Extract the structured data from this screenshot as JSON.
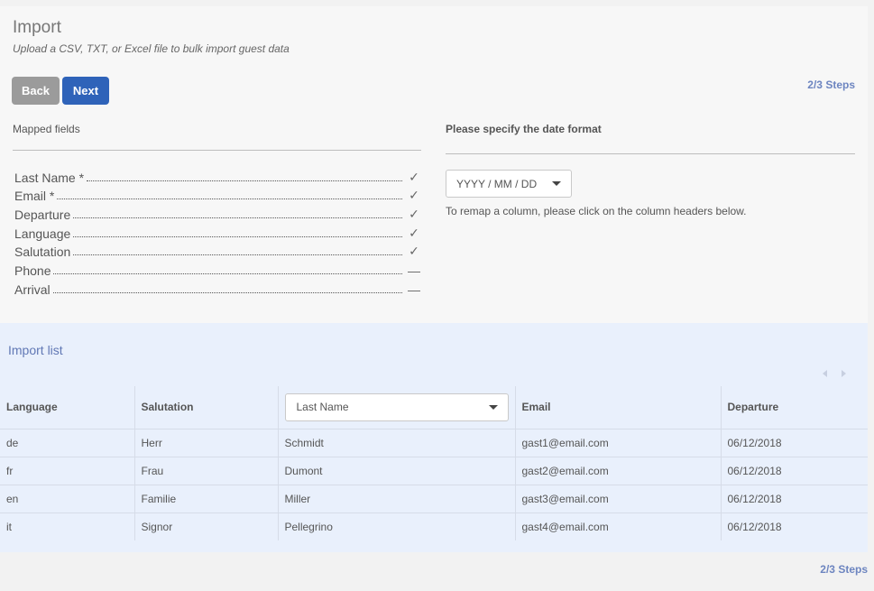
{
  "header": {
    "title": "Import",
    "subtitle": "Upload a CSV, TXT, or Excel file to bulk import guest data"
  },
  "actions": {
    "back_label": "Back",
    "next_label": "Next"
  },
  "steps": {
    "top": "2/3 Steps",
    "bottom": "2/3 Steps"
  },
  "mapped_fields": {
    "header": "Mapped fields",
    "items": [
      {
        "label": "Last Name *",
        "status": "✓",
        "status_icon": "check-icon"
      },
      {
        "label": "Email *",
        "status": "✓",
        "status_icon": "check-icon"
      },
      {
        "label": "Departure",
        "status": "✓",
        "status_icon": "check-icon"
      },
      {
        "label": "Language",
        "status": "✓",
        "status_icon": "check-icon"
      },
      {
        "label": "Salutation",
        "status": "✓",
        "status_icon": "check-icon"
      },
      {
        "label": "Phone",
        "status": "—",
        "status_icon": "dash-icon"
      },
      {
        "label": "Arrival",
        "status": "—",
        "status_icon": "dash-icon"
      }
    ]
  },
  "date_format": {
    "header": "Please specify the date format",
    "selected": "YYYY / MM / DD",
    "hint": "To remap a column, please click on the column headers below."
  },
  "import_list": {
    "title": "Import list",
    "columns": [
      "Language",
      "Salutation",
      "Last Name",
      "Email",
      "Departure"
    ],
    "rows": [
      [
        "de",
        "Herr",
        "Schmidt",
        "gast1@email.com",
        "06/12/2018"
      ],
      [
        "fr",
        "Frau",
        "Dumont",
        "gast2@email.com",
        "06/12/2018"
      ],
      [
        "en",
        "Familie",
        "Miller",
        "gast3@email.com",
        "06/12/2018"
      ],
      [
        "it",
        "Signor",
        "Pellegrino",
        "gast4@email.com",
        "06/12/2018"
      ]
    ]
  },
  "colors": {
    "primary_button": "#2f63b9",
    "secondary_button": "#9b9b9b",
    "steps_text": "#6d85c0",
    "import_panel_bg": "#e9f0fc"
  }
}
